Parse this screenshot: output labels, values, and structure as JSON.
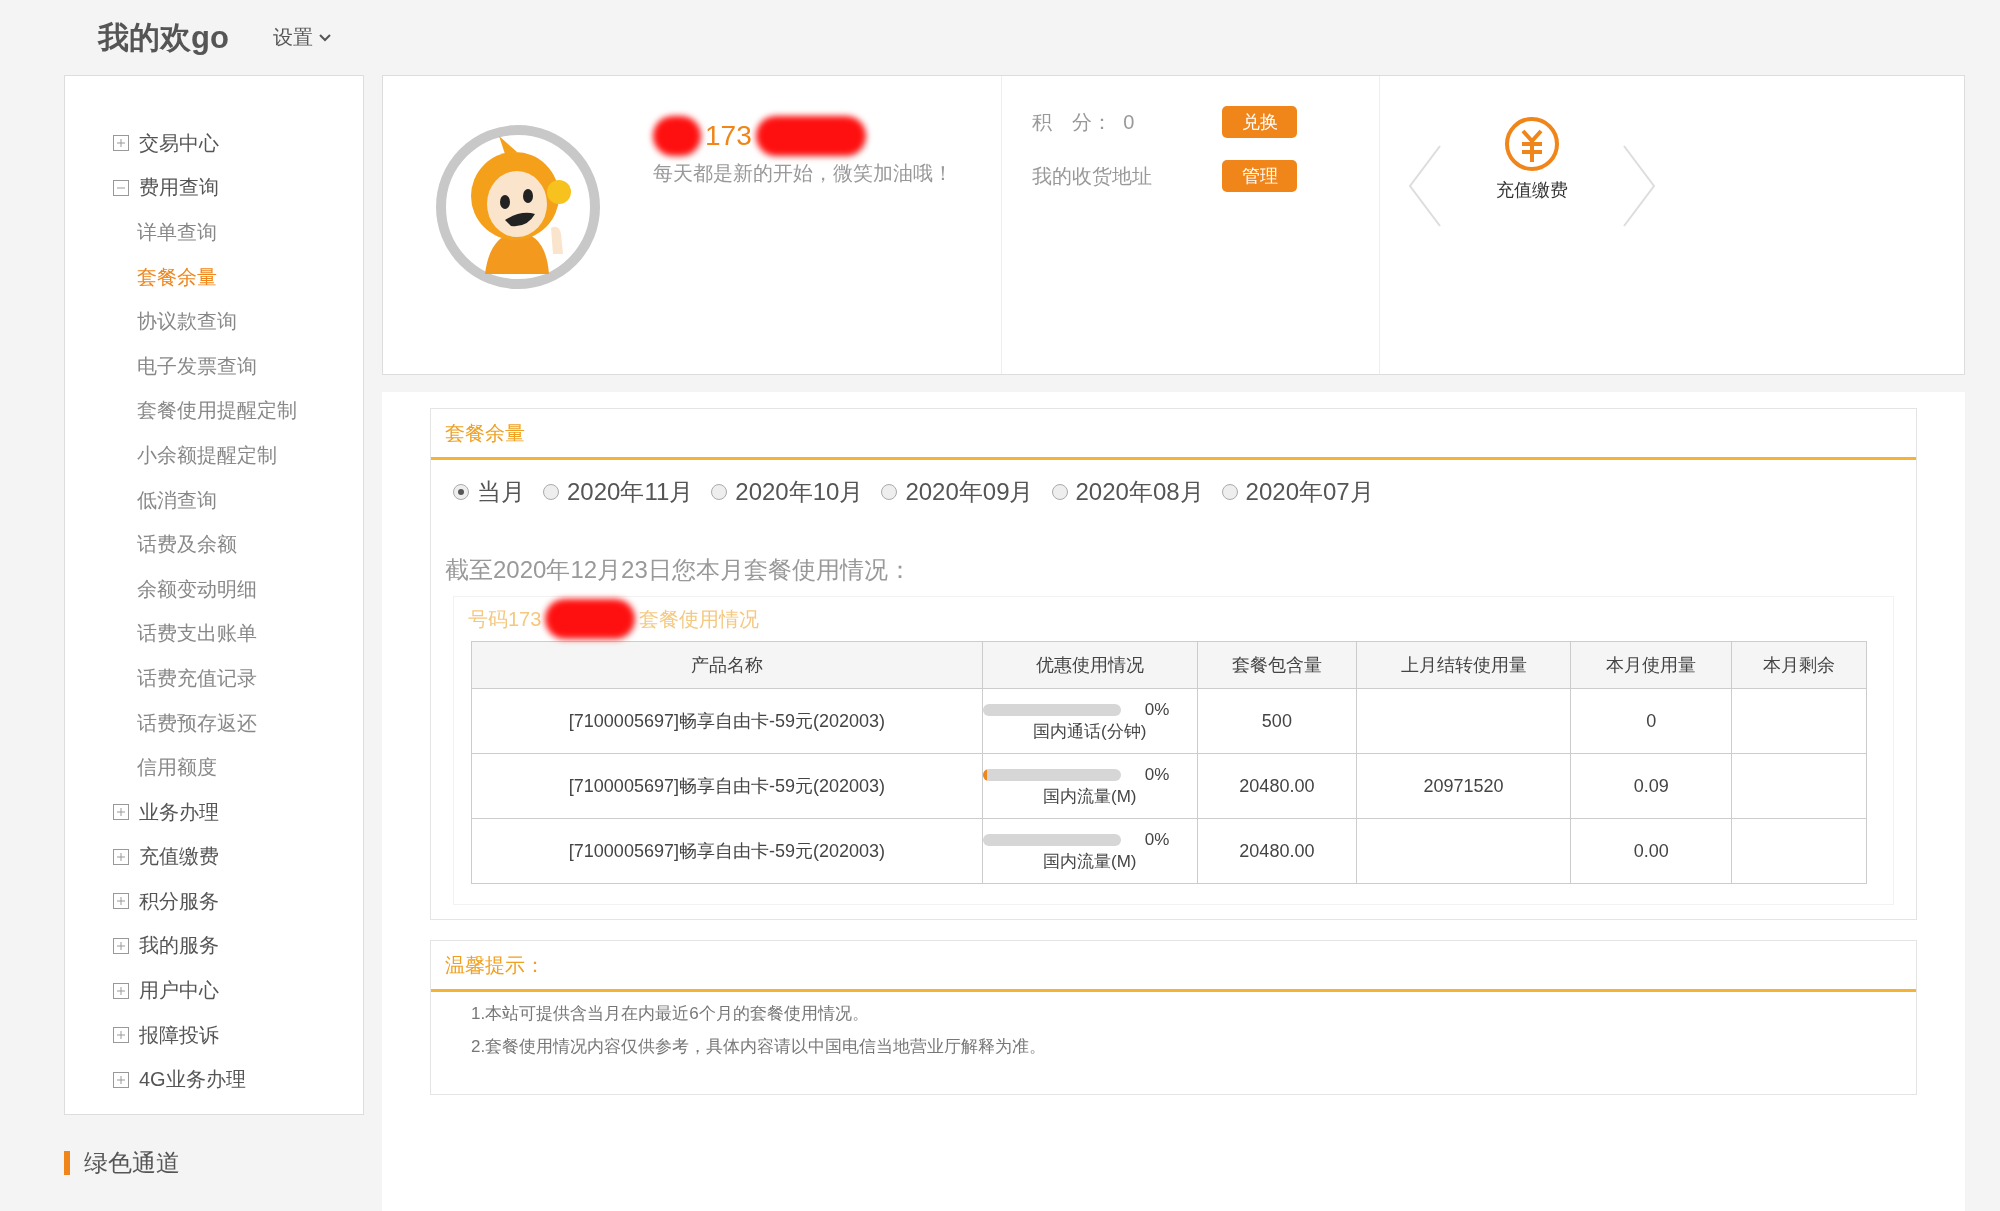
{
  "header": {
    "title": "我的欢go",
    "settings_menu": "设置"
  },
  "sidebar": {
    "items": [
      {
        "label": "交易中心",
        "expanded": false
      },
      {
        "label": "费用查询",
        "expanded": true,
        "children": [
          {
            "label": "详单查询",
            "selected": false
          },
          {
            "label": "套餐余量",
            "selected": true
          },
          {
            "label": "协议款查询",
            "selected": false
          },
          {
            "label": "电子发票查询",
            "selected": false
          },
          {
            "label": "套餐使用提醒定制",
            "selected": false
          },
          {
            "label": "小余额提醒定制",
            "selected": false
          },
          {
            "label": "低消查询",
            "selected": false
          },
          {
            "label": "话费及余额",
            "selected": false
          },
          {
            "label": "余额变动明细",
            "selected": false
          },
          {
            "label": "话费支出账单",
            "selected": false
          },
          {
            "label": "话费充值记录",
            "selected": false
          },
          {
            "label": "话费预存返还",
            "selected": false
          },
          {
            "label": "信用额度",
            "selected": false
          }
        ]
      },
      {
        "label": "业务办理",
        "expanded": false
      },
      {
        "label": "充值缴费",
        "expanded": false
      },
      {
        "label": "积分服务",
        "expanded": false
      },
      {
        "label": "我的服务",
        "expanded": false
      },
      {
        "label": "用户中心",
        "expanded": false
      },
      {
        "label": "报障投诉",
        "expanded": false
      },
      {
        "label": "4G业务办理",
        "expanded": false
      }
    ]
  },
  "green_channel": "绿色通道",
  "profile": {
    "phone": "173",
    "motto": "每天都是新的开始，微笑加油哦！",
    "points_label": "积　分：",
    "points": "0",
    "exchange_button": "兑换",
    "address_label": "我的收货地址",
    "manage_button": "管理",
    "quick_link": "充值缴费"
  },
  "package_balance": {
    "title": "套餐余量",
    "months": [
      {
        "label": "当月",
        "selected": true
      },
      {
        "label": "2020年11月",
        "selected": false
      },
      {
        "label": "2020年10月",
        "selected": false
      },
      {
        "label": "2020年09月",
        "selected": false
      },
      {
        "label": "2020年08月",
        "selected": false
      },
      {
        "label": "2020年07月",
        "selected": false
      }
    ],
    "as_of": "截至2020年12月23日您本月套餐使用情况：",
    "number_label": "号码173",
    "usage_title": "套餐使用情况",
    "table": {
      "columns": [
        "产品名称",
        "优惠使用情况",
        "套餐包含量",
        "上月结转使用量",
        "本月使用量",
        "本月剩余"
      ],
      "rows": [
        {
          "product": "[7100005697]畅享自由卡-59元(202003)",
          "level": 0,
          "percent": "0%",
          "usage_type": "国内通话(分钟)",
          "included": "500",
          "used": "0"
        },
        {
          "product": "[7100005697]畅享自由卡-59元(202003)",
          "level": 0.03,
          "percent": "0%",
          "usage_type": "国内流量(M)",
          "included": "20480.00",
          "carried_over": "20971520",
          "used": "0.09"
        },
        {
          "product": "[7100005697]畅享自由卡-59元(202003)",
          "level": 0,
          "percent": "0%",
          "usage_type": "国内流量(M)",
          "included": "20480.00",
          "used": "0.00"
        }
      ]
    }
  },
  "tips": {
    "title": "温馨提示：",
    "items": [
      "1.本站可提供含当月在内最近6个月的套餐使用情况。",
      "2.套餐使用情况内容仅供参考，具体内容请以中国电信当地营业厅解释为准。"
    ]
  }
}
